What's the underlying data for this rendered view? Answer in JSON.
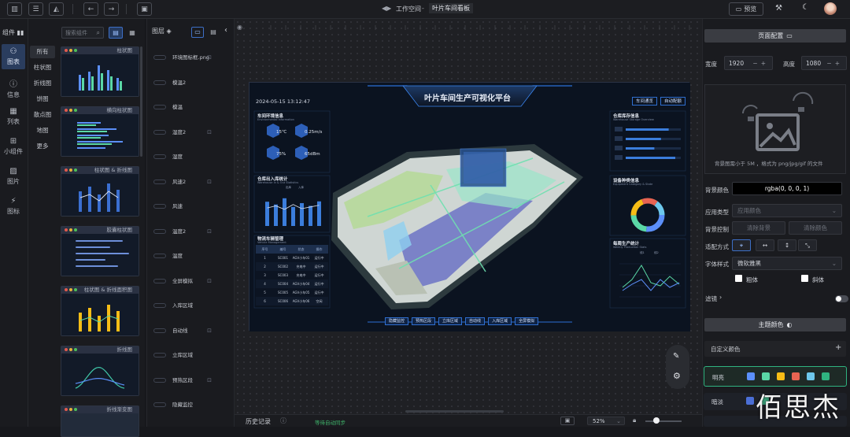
{
  "toolbar": {
    "workspace_label": "工作空间",
    "separator": " - ",
    "project_name": "叶片车间看板",
    "preview_label": "预览"
  },
  "rail": {
    "items": [
      {
        "label": "图表",
        "icon": "chart-icon"
      },
      {
        "label": "信息",
        "icon": "info-icon"
      },
      {
        "label": "列表",
        "icon": "table-icon"
      },
      {
        "label": "小组件",
        "icon": "widget-icon"
      },
      {
        "label": "图片",
        "icon": "image-icon"
      },
      {
        "label": "图标",
        "icon": "icon-icon"
      }
    ]
  },
  "components": {
    "title": "组件",
    "search_placeholder": "搜索组件",
    "categories": [
      "所有",
      "柱状图",
      "折线图",
      "饼图",
      "散点图",
      "地图",
      "更多"
    ],
    "thumbs": [
      "柱状图",
      "横向柱状图",
      "柱状图 & 折线图",
      "胶囊柱状图",
      "柱状图 & 折线面积图",
      "折线图",
      "折线渐变图"
    ]
  },
  "layers": {
    "title": "图层",
    "items": [
      "环境图标框.png",
      "模温2",
      "模温",
      "湿度2",
      "湿度",
      "风速2",
      "风速",
      "温度2",
      "温度",
      "全屏模拟",
      "入库区域",
      "自动线",
      "立库区域",
      "预热区段",
      "隐藏监控"
    ]
  },
  "board": {
    "title": "叶片车间生产可视化平台",
    "datetime": "2024-05-15  13:12:47",
    "btn_left": "车间通览",
    "btn_right": "自动配额",
    "env_title": "车间环境信息",
    "env_sub": "Environmental Information",
    "env_values": [
      "15℃",
      "0.25m/s",
      "75%",
      "65dBm"
    ],
    "inout_title": "仓库出入库统计",
    "inout_sub": "Warehouse In & Out Statistics",
    "inout_legend": [
      "出库",
      "入库"
    ],
    "inout_bars": [
      70,
      62,
      80,
      55,
      66,
      58,
      71
    ],
    "inout_line": [
      52,
      58,
      48,
      62,
      50,
      55,
      60
    ],
    "equip_title": "物流车辆管理",
    "equip_sub": "Vehicle Management",
    "equip_headers": [
      "序号",
      "编号",
      "状态",
      "操作"
    ],
    "equip_rows": [
      [
        "1",
        "SC001",
        "AGV小车01",
        "运行中"
      ],
      [
        "2",
        "SC002",
        "充电中",
        "运行中"
      ],
      [
        "3",
        "SC003",
        "充电中",
        "运行中"
      ],
      [
        "4",
        "SC004",
        "AGV小车04",
        "运行中"
      ],
      [
        "5",
        "SC005",
        "AGV小车05",
        "运行中"
      ],
      [
        "6",
        "SC006",
        "AGV小车06",
        "空闲"
      ]
    ],
    "stock_title": "仓库库存信息",
    "stock_sub": "Warehouse Storage Overview",
    "stock_values": [
      0.78,
      0.64,
      0.52,
      0.9
    ],
    "equip2_title": "设备种类信息",
    "equip2_sub": "Equipment Category & State",
    "daily_title": "每周生产统计",
    "daily_sub": "Weekly Production Stats",
    "daily_legend": [
      "线1",
      "线2"
    ],
    "bottom_nav": [
      "隐藏监控",
      "预热区段",
      "立库区域",
      "自动线",
      "入库区域",
      "全屏模拟"
    ]
  },
  "right": {
    "page_config": "页面配置",
    "width_label": "宽度",
    "width_value": "1920",
    "height_label": "高度",
    "height_value": "1080",
    "upload_hint": "背景图需小于 5M ，格式为 png/jpg/gif 的文件",
    "bg_color_label": "背景颜色",
    "bg_color_value": "rgba(0, 0, 0, 1)",
    "app_type_label": "应用类型",
    "app_type_value": "应用颜色",
    "bg_control_label": "背景控制",
    "clear_bg": "清除背景",
    "clear_color": "清除颜色",
    "fit_label": "适配方式",
    "font_style_label": "字体样式",
    "font_value": "微软雅黑",
    "bold_label": "粗体",
    "italic_label": "斜体",
    "filter_label": "滤镜",
    "theme_label": "主题颜色",
    "custom_color": "自定义颜色",
    "themes": [
      {
        "name": "明亮",
        "colors": [
          "#5b8ff9",
          "#5ad8a6",
          "#f6bd16",
          "#e86452",
          "#6dc8ec",
          "#2fb380"
        ]
      },
      {
        "name": "暗淡",
        "colors": [
          "#4b6fd6",
          "#3da87f"
        ]
      }
    ]
  },
  "status": {
    "history_label": "历史记录",
    "autosave": "等待自动同步",
    "zoom": "52%"
  },
  "watermark": "佰思杰"
}
